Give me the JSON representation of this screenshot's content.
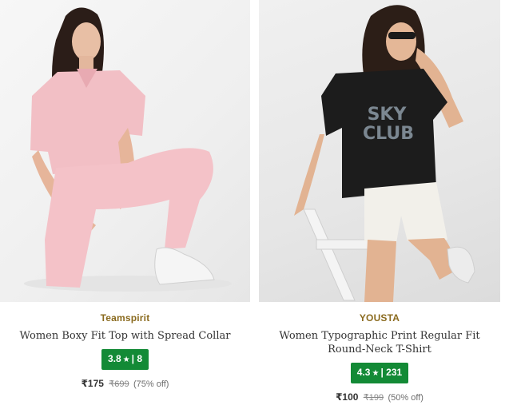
{
  "products": [
    {
      "brand": "Teamspirit",
      "title": "Women Boxy Fit Top with Spread Collar",
      "rating": "3.8",
      "rating_count": "8",
      "price": "₹175",
      "mrp": "₹699",
      "discount": "(75% off)",
      "rating_color": "#138a36",
      "brand_color": "#8a6a1e"
    },
    {
      "brand": "YOUSTA",
      "title": "Women Typographic Print Regular Fit Round-Neck T-Shirt",
      "rating": "4.3",
      "rating_count": "231",
      "price": "₹100",
      "mrp": "₹199",
      "discount": "(50% off)",
      "rating_color": "#138a36",
      "brand_color": "#8a6a1e"
    }
  ],
  "icons": {
    "rating_star": "star-icon"
  }
}
